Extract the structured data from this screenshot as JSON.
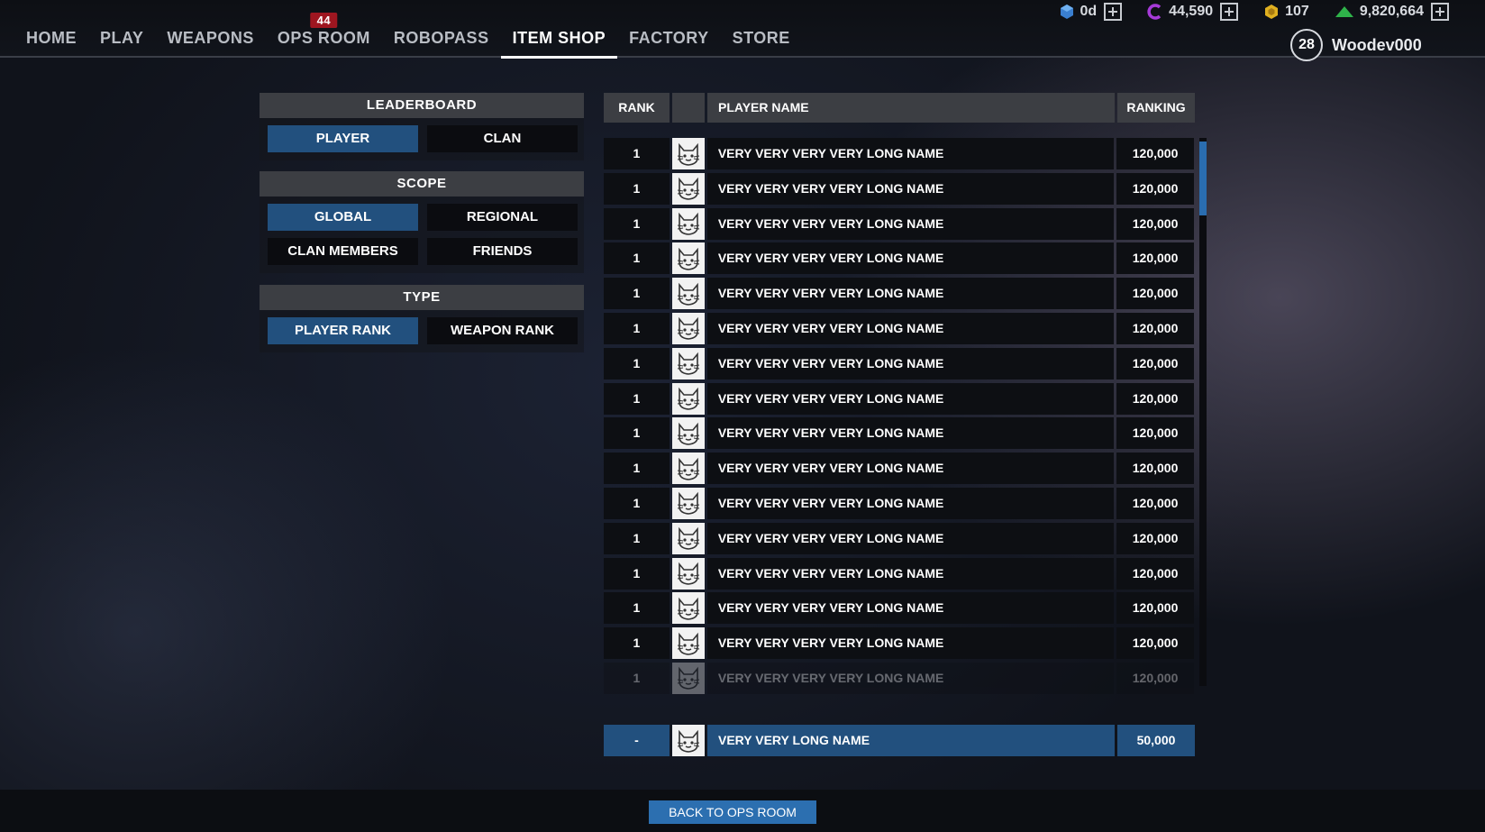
{
  "nav": {
    "items": [
      {
        "label": "HOME",
        "active": false
      },
      {
        "label": "PLAY",
        "active": false
      },
      {
        "label": "WEAPONS",
        "active": false
      },
      {
        "label": "OPS ROOM",
        "active": false,
        "badge": "44"
      },
      {
        "label": "ROBOPASS",
        "active": false
      },
      {
        "label": "ITEM SHOP",
        "active": true
      },
      {
        "label": "FACTORY",
        "active": false
      },
      {
        "label": "STORE",
        "active": false
      }
    ]
  },
  "currencies": [
    {
      "icon": "cube-icon",
      "value": "0d",
      "color": "#3a7fd0",
      "addable": true
    },
    {
      "icon": "c-coin-icon",
      "value": "44,590",
      "color": "#a63ad8",
      "addable": true
    },
    {
      "icon": "gold-hex-icon",
      "value": "107",
      "color": "#e0b020",
      "addable": false
    },
    {
      "icon": "green-triangle-icon",
      "value": "9,820,664",
      "color": "#2fb34a",
      "addable": true
    }
  ],
  "profile": {
    "level": "28",
    "username": "Woodev000"
  },
  "leaderboard": {
    "title": "LEADERBOARD",
    "options": [
      {
        "label": "PLAYER",
        "selected": true
      },
      {
        "label": "CLAN",
        "selected": false
      }
    ]
  },
  "scope": {
    "title": "SCOPE",
    "options": [
      {
        "label": "GLOBAL",
        "selected": true
      },
      {
        "label": "REGIONAL",
        "selected": false
      },
      {
        "label": "CLAN MEMBERS",
        "selected": false
      },
      {
        "label": "FRIENDS",
        "selected": false
      }
    ]
  },
  "type": {
    "title": "TYPE",
    "options": [
      {
        "label": "PLAYER RANK",
        "selected": true
      },
      {
        "label": "WEAPON RANK",
        "selected": false
      }
    ]
  },
  "table": {
    "headers": {
      "rank": "RANK",
      "name": "PLAYER NAME",
      "score": "RANKING"
    },
    "rows": [
      {
        "rank": "1",
        "name": "VERY VERY VERY VERY LONG NAME",
        "score": "120,000"
      },
      {
        "rank": "1",
        "name": "VERY VERY VERY VERY LONG NAME",
        "score": "120,000"
      },
      {
        "rank": "1",
        "name": "VERY VERY VERY VERY LONG NAME",
        "score": "120,000"
      },
      {
        "rank": "1",
        "name": "VERY VERY VERY VERY LONG NAME",
        "score": "120,000"
      },
      {
        "rank": "1",
        "name": "VERY VERY VERY VERY LONG NAME",
        "score": "120,000"
      },
      {
        "rank": "1",
        "name": "VERY VERY VERY VERY LONG NAME",
        "score": "120,000"
      },
      {
        "rank": "1",
        "name": "VERY VERY VERY VERY LONG NAME",
        "score": "120,000"
      },
      {
        "rank": "1",
        "name": "VERY VERY VERY VERY LONG NAME",
        "score": "120,000"
      },
      {
        "rank": "1",
        "name": "VERY VERY VERY VERY LONG NAME",
        "score": "120,000"
      },
      {
        "rank": "1",
        "name": "VERY VERY VERY VERY LONG NAME",
        "score": "120,000"
      },
      {
        "rank": "1",
        "name": "VERY VERY VERY VERY LONG NAME",
        "score": "120,000"
      },
      {
        "rank": "1",
        "name": "VERY VERY VERY VERY LONG NAME",
        "score": "120,000"
      },
      {
        "rank": "1",
        "name": "VERY VERY VERY VERY LONG NAME",
        "score": "120,000"
      },
      {
        "rank": "1",
        "name": "VERY VERY VERY VERY LONG NAME",
        "score": "120,000"
      },
      {
        "rank": "1",
        "name": "VERY VERY VERY VERY LONG NAME",
        "score": "120,000"
      },
      {
        "rank": "1",
        "name": "VERY VERY VERY VERY LONG NAME",
        "score": "120,000"
      }
    ],
    "self": {
      "rank": "-",
      "name": "VERY VERY LONG NAME",
      "score": "50,000"
    }
  },
  "footer": {
    "back_label": "BACK TO OPS ROOM"
  },
  "colors": {
    "selected": "#22507e",
    "accent": "#2c6fb0",
    "badge": "#9e1620"
  }
}
